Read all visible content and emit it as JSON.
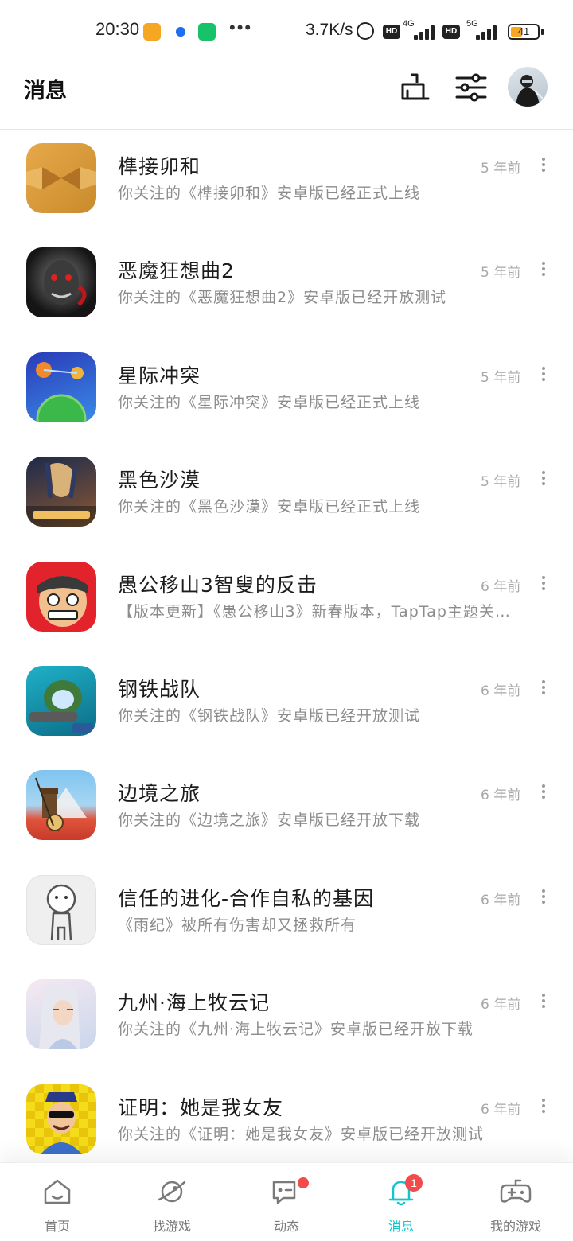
{
  "status_bar": {
    "time": "20:30",
    "dots": "•••",
    "net_speed": "3.7K/s",
    "hd_label": "HD",
    "net1": "4G",
    "net2": "5G",
    "battery": "41"
  },
  "header": {
    "title": "消息",
    "icons": [
      "clean-icon",
      "filter-icon",
      "avatar"
    ]
  },
  "messages": [
    {
      "title": "榫接卯和",
      "subtitle": "你关注的《榫接卯和》安卓版已经正式上线",
      "time": "5 年前"
    },
    {
      "title": "恶魔狂想曲2",
      "subtitle": "你关注的《恶魔狂想曲2》安卓版已经开放测试",
      "time": "5 年前"
    },
    {
      "title": "星际冲突",
      "subtitle": "你关注的《星际冲突》安卓版已经正式上线",
      "time": "5 年前"
    },
    {
      "title": "黑色沙漠",
      "subtitle": "你关注的《黑色沙漠》安卓版已经正式上线",
      "time": "5 年前"
    },
    {
      "title": "愚公移山3智叟的反击",
      "subtitle": "【版本更新】《愚公移山3》新春版本，TapTap主题关…",
      "time": "6 年前"
    },
    {
      "title": "钢铁战队",
      "subtitle": "你关注的《钢铁战队》安卓版已经开放测试",
      "time": "6 年前"
    },
    {
      "title": "边境之旅",
      "subtitle": "你关注的《边境之旅》安卓版已经开放下载",
      "time": "6 年前"
    },
    {
      "title": "信任的进化-合作自私的基因",
      "subtitle": "《雨纪》被所有伤害却又拯救所有",
      "time": "6 年前"
    },
    {
      "title": "九州·海上牧云记",
      "subtitle": "你关注的《九州·海上牧云记》安卓版已经开放下载",
      "time": "6 年前"
    },
    {
      "title": "证明：她是我女友",
      "subtitle": "你关注的《证明：她是我女友》安卓版已经开放测试",
      "time": "6 年前"
    }
  ],
  "tabs": [
    {
      "label": "首页",
      "icon": "home-icon"
    },
    {
      "label": "找游戏",
      "icon": "planet-icon"
    },
    {
      "label": "动态",
      "icon": "chat-icon",
      "dot": true
    },
    {
      "label": "消息",
      "icon": "bell-icon",
      "badge": "1",
      "active": true
    },
    {
      "label": "我的游戏",
      "icon": "gamepad-icon"
    }
  ],
  "colors": {
    "accent": "#15c5ce",
    "badge": "#f24b4b",
    "title_text": "#1c1c1c",
    "subtitle_text": "#8c8c8c",
    "time_text": "#a8a8a8"
  }
}
